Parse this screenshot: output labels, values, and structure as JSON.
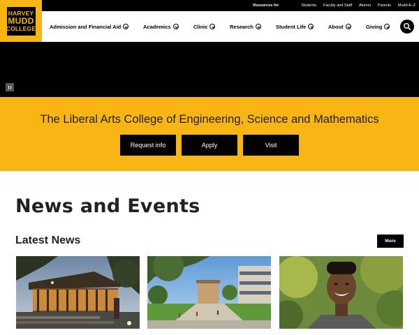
{
  "logo": {
    "line1": "HARVEY",
    "line2": "MUDD",
    "line3": "COLLEGE"
  },
  "topbar": {
    "label": "Resources for",
    "links": [
      "Students",
      "Faculty and Staff",
      "Alumni",
      "Parents",
      "Mudd A–Z"
    ]
  },
  "nav": {
    "items": [
      {
        "label": "Admission and Financial Aid"
      },
      {
        "label": "Academics"
      },
      {
        "label": "Clinic"
      },
      {
        "label": "Research"
      },
      {
        "label": "Student Life"
      },
      {
        "label": "About"
      },
      {
        "label": "Giving"
      }
    ],
    "search_icon": "search-icon"
  },
  "video": {
    "pause_icon": "pause-icon"
  },
  "hero": {
    "tagline": "The Liberal Arts College of Engineering, Science and Mathematics",
    "buttons": [
      "Request info",
      "Apply",
      "Visit"
    ]
  },
  "news": {
    "section_title": "News and Events",
    "subtitle": "Latest News",
    "more_label": "More"
  },
  "colors": {
    "brand_gold": "#f8b514",
    "black": "#000000"
  }
}
